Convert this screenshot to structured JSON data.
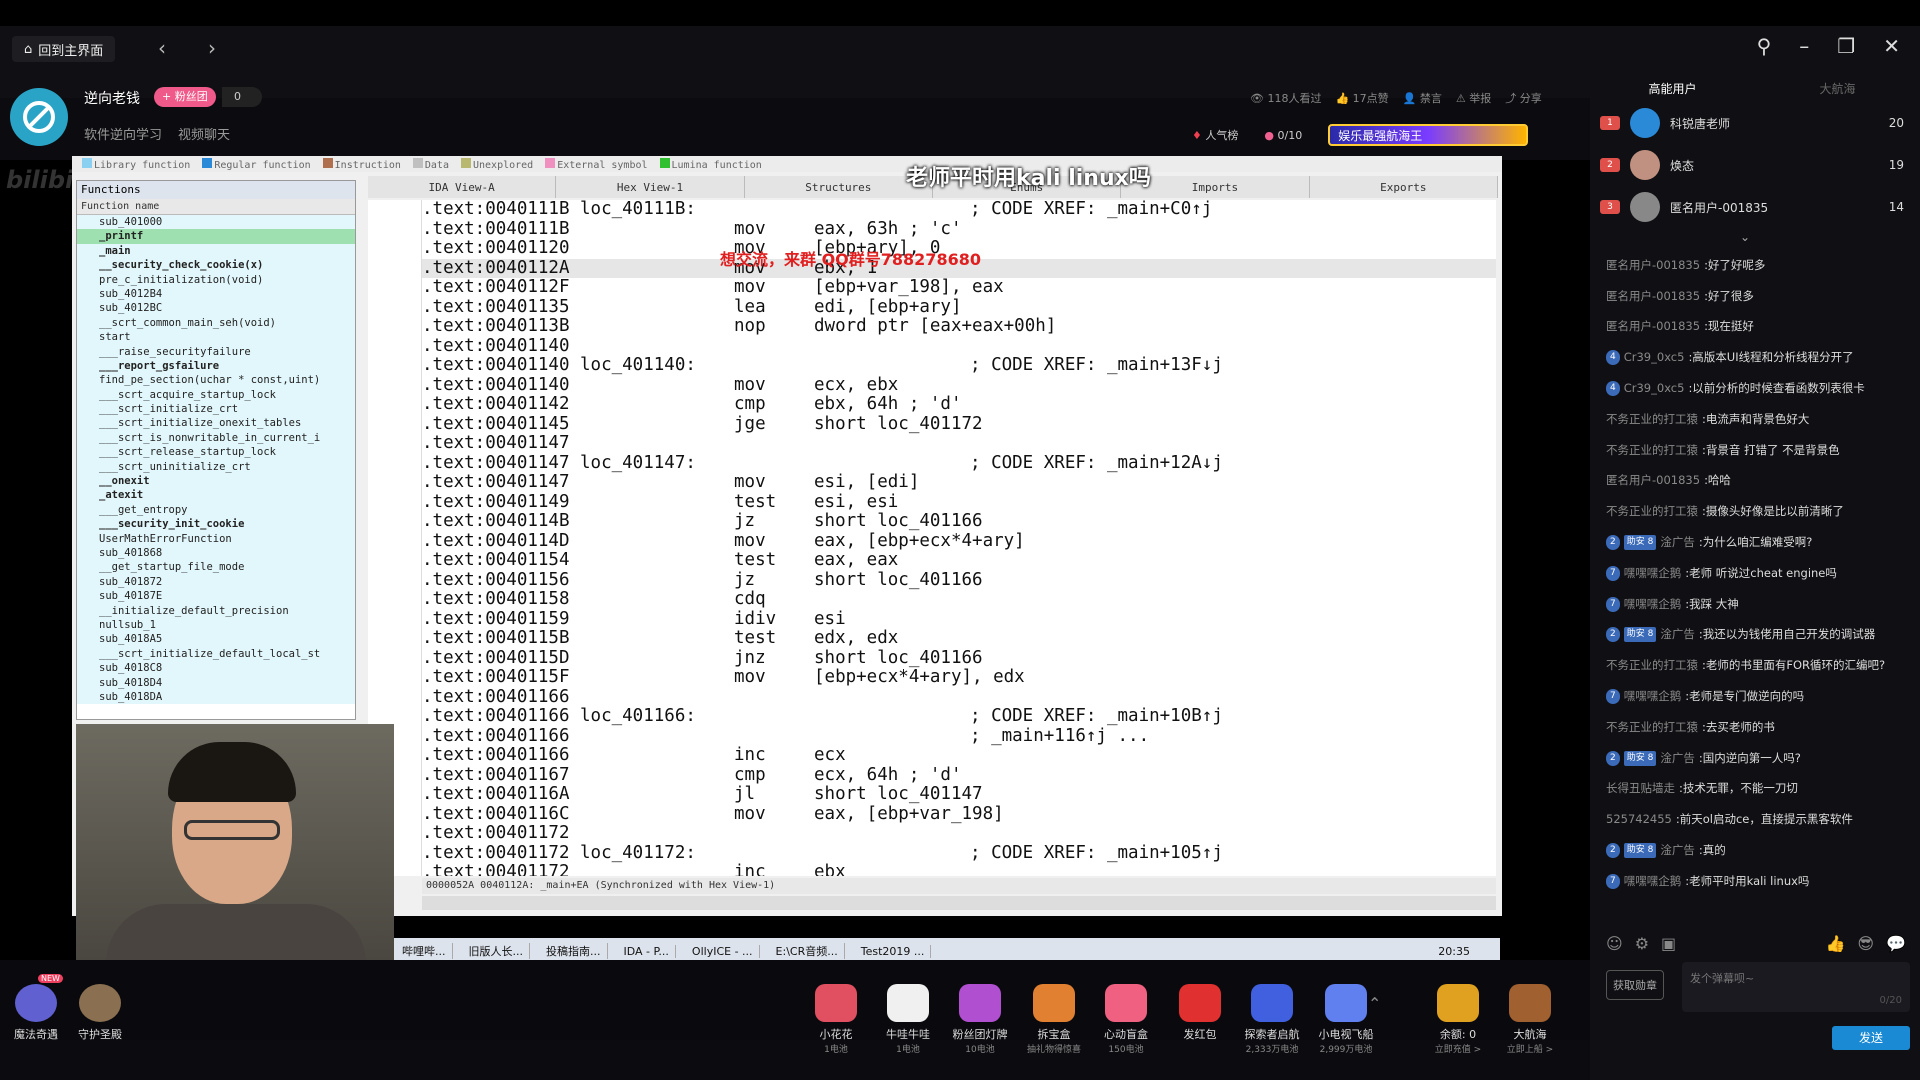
{
  "topbar": {
    "home_label": "回到主界面",
    "back_icon": "‹",
    "forward_icon": "›",
    "streamer_name": "逆向老钱",
    "fan_badge": "+ 粉丝团",
    "fan_count": "0",
    "tags": [
      "软件逆向学习",
      "视频聊天"
    ],
    "stats": [
      "118人看过",
      "17点赞",
      "禁言",
      "举报",
      "分享"
    ],
    "popularity": "人气榜",
    "gift_counter": "0/10",
    "banner_text": "娱乐最强航海王"
  },
  "ida": {
    "legend": [
      {
        "label": "Library function",
        "color": "#8ad0f0"
      },
      {
        "label": "Regular function",
        "color": "#2a8ad8"
      },
      {
        "label": "Instruction",
        "color": "#b07050"
      },
      {
        "label": "Data",
        "color": "#c0c0c0"
      },
      {
        "label": "Unexplored",
        "color": "#b8b870"
      },
      {
        "label": "External symbol",
        "color": "#f090c0"
      },
      {
        "label": "Lumina function",
        "color": "#30c030"
      }
    ],
    "functions_title": "Functions",
    "function_header": "Function name",
    "functions": [
      "sub_401000",
      "_printf",
      "_main",
      "__security_check_cookie(x)",
      "pre_c_initialization(void)",
      "sub_4012B4",
      "sub_4012BC",
      "__scrt_common_main_seh(void)",
      "start",
      "___raise_securityfailure",
      "___report_gsfailure",
      "find_pe_section(uchar * const,uint)",
      "___scrt_acquire_startup_lock",
      "___scrt_initialize_crt",
      "___scrt_initialize_onexit_tables",
      "___scrt_is_nonwritable_in_current_i",
      "___scrt_release_startup_lock",
      "___scrt_uninitialize_crt",
      "__onexit",
      "_atexit",
      "___get_entropy",
      "___security_init_cookie",
      "UserMathErrorFunction",
      "sub_401868",
      "__get_startup_file_mode",
      "sub_401872",
      "sub_40187E",
      "__initialize_default_precision",
      "nullsub_1",
      "sub_4018A5",
      "___scrt_initialize_default_local_st",
      "sub_4018C8",
      "sub_4018D4",
      "sub_4018DA"
    ],
    "tabs": [
      "IDA View-A",
      "Hex View-1",
      "Structures",
      "Enums",
      "Imports",
      "Exports"
    ],
    "code": [
      {
        "a": ".text:0040111B",
        "l": "loc_40111B:",
        "m": "",
        "o": "",
        "c": "; CODE XREF: _main+C0↑j"
      },
      {
        "a": ".text:0040111B",
        "l": "",
        "m": "mov",
        "o": "eax, 63h ; 'c'",
        "c": ""
      },
      {
        "a": ".text:00401120",
        "l": "",
        "m": "mov",
        "o": "[ebp+ary], 0",
        "c": ""
      },
      {
        "a": ".text:0040112A",
        "l": "",
        "m": "mov",
        "o": "ebx, 1",
        "c": ""
      },
      {
        "a": ".text:0040112F",
        "l": "",
        "m": "mov",
        "o": "[ebp+var_198], eax",
        "c": ""
      },
      {
        "a": ".text:00401135",
        "l": "",
        "m": "lea",
        "o": "edi, [ebp+ary]",
        "c": ""
      },
      {
        "a": ".text:0040113B",
        "l": "",
        "m": "nop",
        "o": "dword ptr [eax+eax+00h]",
        "c": ""
      },
      {
        "a": ".text:00401140",
        "l": "",
        "m": "",
        "o": "",
        "c": ""
      },
      {
        "a": ".text:00401140",
        "l": "loc_401140:",
        "m": "",
        "o": "",
        "c": "; CODE XREF: _main+13F↓j"
      },
      {
        "a": ".text:00401140",
        "l": "",
        "m": "mov",
        "o": "ecx, ebx",
        "c": ""
      },
      {
        "a": ".text:00401142",
        "l": "",
        "m": "cmp",
        "o": "ebx, 64h ; 'd'",
        "c": ""
      },
      {
        "a": ".text:00401145",
        "l": "",
        "m": "jge",
        "o": "short loc_401172",
        "c": ""
      },
      {
        "a": ".text:00401147",
        "l": "",
        "m": "",
        "o": "",
        "c": ""
      },
      {
        "a": ".text:00401147",
        "l": "loc_401147:",
        "m": "",
        "o": "",
        "c": "; CODE XREF: _main+12A↓j"
      },
      {
        "a": ".text:00401147",
        "l": "",
        "m": "mov",
        "o": "esi, [edi]",
        "c": ""
      },
      {
        "a": ".text:00401149",
        "l": "",
        "m": "test",
        "o": "esi, esi",
        "c": ""
      },
      {
        "a": ".text:0040114B",
        "l": "",
        "m": "jz",
        "o": "short loc_401166",
        "c": ""
      },
      {
        "a": ".text:0040114D",
        "l": "",
        "m": "mov",
        "o": "eax, [ebp+ecx*4+ary]",
        "c": ""
      },
      {
        "a": ".text:00401154",
        "l": "",
        "m": "test",
        "o": "eax, eax",
        "c": ""
      },
      {
        "a": ".text:00401156",
        "l": "",
        "m": "jz",
        "o": "short loc_401166",
        "c": ""
      },
      {
        "a": ".text:00401158",
        "l": "",
        "m": "cdq",
        "o": "",
        "c": ""
      },
      {
        "a": ".text:00401159",
        "l": "",
        "m": "idiv",
        "o": "esi",
        "c": ""
      },
      {
        "a": ".text:0040115B",
        "l": "",
        "m": "test",
        "o": "edx, edx",
        "c": ""
      },
      {
        "a": ".text:0040115D",
        "l": "",
        "m": "jnz",
        "o": "short loc_401166",
        "c": ""
      },
      {
        "a": ".text:0040115F",
        "l": "",
        "m": "mov",
        "o": "[ebp+ecx*4+ary], edx",
        "c": ""
      },
      {
        "a": ".text:00401166",
        "l": "",
        "m": "",
        "o": "",
        "c": ""
      },
      {
        "a": ".text:00401166",
        "l": "loc_401166:",
        "m": "",
        "o": "",
        "c": "; CODE XREF: _main+10B↑j"
      },
      {
        "a": ".text:00401166",
        "l": "",
        "m": "",
        "o": "",
        "c": "; _main+116↑j ..."
      },
      {
        "a": ".text:00401166",
        "l": "",
        "m": "inc",
        "o": "ecx",
        "c": ""
      },
      {
        "a": ".text:00401167",
        "l": "",
        "m": "cmp",
        "o": "ecx, 64h ; 'd'",
        "c": ""
      },
      {
        "a": ".text:0040116A",
        "l": "",
        "m": "jl",
        "o": "short loc_401147",
        "c": ""
      },
      {
        "a": ".text:0040116C",
        "l": "",
        "m": "mov",
        "o": "eax, [ebp+var_198]",
        "c": ""
      },
      {
        "a": ".text:00401172",
        "l": "",
        "m": "",
        "o": "",
        "c": ""
      },
      {
        "a": ".text:00401172",
        "l": "loc_401172:",
        "m": "",
        "o": "",
        "c": "; CODE XREF: _main+105↑j"
      },
      {
        "a": ".text:00401172",
        "l": "",
        "m": "inc",
        "o": "ebx",
        "c": ""
      }
    ],
    "status": "0000052A 0040112A: _main+EA (Synchronized with Hex View-1)",
    "taskbar": [
      "哔哩哔...",
      "旧版人长...",
      "投稿指南...",
      "IDA - P...",
      "OllyICE - ...",
      "E:\\CR音频...",
      "Test2019 ..."
    ],
    "clock": "20:35"
  },
  "overlays": {
    "caption": "老师平时用kali linux吗",
    "red_text": "想交流，来群 QQ群号788278680"
  },
  "bottom": {
    "left_items": [
      {
        "label": "魔法奇遇",
        "badge": "NEW"
      },
      {
        "label": "守护圣殿"
      }
    ],
    "gifts": [
      {
        "label": "小花花",
        "sub": "1电池",
        "color": "#e05060"
      },
      {
        "label": "牛哇牛哇",
        "sub": "1电池",
        "color": "#f0f0f0"
      },
      {
        "label": "粉丝团灯牌",
        "sub": "10电池",
        "color": "#b050d0"
      },
      {
        "label": "拆宝盒",
        "sub": "抽礼物得惊喜",
        "color": "#e08030"
      },
      {
        "label": "心动盲盒",
        "sub": "150电池",
        "color": "#f06080"
      },
      {
        "label": "发红包",
        "sub": "",
        "color": "#e03030"
      },
      {
        "label": "探索者启航",
        "sub": "2,333万电池",
        "color": "#4060e0"
      },
      {
        "label": "小电视飞船",
        "sub": "2,999万电池",
        "color": "#6080f0"
      },
      {
        "label": "余额: 0",
        "sub": "立即充值 >",
        "color": "#e0a020"
      },
      {
        "label": "大航海",
        "sub": "立即上船 >",
        "color": "#a06030"
      }
    ]
  },
  "side": {
    "tabs": [
      "高能用户",
      "大航海"
    ],
    "top_users": [
      {
        "rank": "1",
        "name": "科锐唐老师",
        "points": "20",
        "color": "#2a8ad8"
      },
      {
        "rank": "2",
        "name": "焕态",
        "points": "19",
        "color": "#c09080"
      },
      {
        "rank": "3",
        "name": "匿名用户-001835",
        "points": "14",
        "color": "#888"
      }
    ],
    "chat": [
      {
        "lvl": "",
        "tag": "",
        "user": "匿名用户-001835",
        "text": ":好了好呢多"
      },
      {
        "lvl": "",
        "tag": "",
        "user": "匿名用户-001835",
        "text": ":好了很多"
      },
      {
        "lvl": "",
        "tag": "",
        "user": "匿名用户-001835",
        "text": ":现在挺好"
      },
      {
        "lvl": "4",
        "tag": "",
        "user": "Cr39_0xc5",
        "text": ":高版本UI线程和分析线程分开了"
      },
      {
        "lvl": "4",
        "tag": "",
        "user": "Cr39_0xc5",
        "text": ":以前分析的时候查看函数列表很卡"
      },
      {
        "lvl": "",
        "tag": "",
        "user": "不务正业的打工猿",
        "text": ":电流声和背景色好大"
      },
      {
        "lvl": "",
        "tag": "",
        "user": "不务正业的打工猿",
        "text": ":背景音 打错了 不是背景色"
      },
      {
        "lvl": "",
        "tag": "",
        "user": "匿名用户-001835",
        "text": ":哈哈"
      },
      {
        "lvl": "",
        "tag": "",
        "user": "不务正业的打工猿",
        "text": ":摄像头好像是比以前清晰了"
      },
      {
        "lvl": "2",
        "tag": "助安 8",
        "user": "淦广告",
        "text": ":为什么咱汇编难受啊?"
      },
      {
        "lvl": "7",
        "tag": "",
        "user": "嘿嘿嘿企鹅",
        "text": ":老师 听说过cheat engine吗"
      },
      {
        "lvl": "7",
        "tag": "",
        "user": "嘿嘿嘿企鹅",
        "text": ":我踩 大神"
      },
      {
        "lvl": "2",
        "tag": "助安 8",
        "user": "淦广告",
        "text": ":我还以为钱佬用自己开发的调试器"
      },
      {
        "lvl": "",
        "tag": "",
        "user": "不务正业的打工猿",
        "text": ":老师的书里面有FOR循环的汇编吧?"
      },
      {
        "lvl": "7",
        "tag": "",
        "user": "嘿嘿嘿企鹅",
        "text": ":老师是专门做逆向的吗"
      },
      {
        "lvl": "",
        "tag": "",
        "user": "不务正业的打工猿",
        "text": ":去买老师的书"
      },
      {
        "lvl": "2",
        "tag": "助安 8",
        "user": "淦广告",
        "text": ":国内逆向第一人吗?"
      },
      {
        "lvl": "",
        "tag": "",
        "user": "长得丑贴墙走",
        "text": ":技术无罪，不能一刀切"
      },
      {
        "lvl": "",
        "tag": "",
        "user": "525742455",
        "text": ":前天ol启动ce，直接提示黑客软件"
      },
      {
        "lvl": "2",
        "tag": "助安 8",
        "user": "淦广告",
        "text": ":真的"
      },
      {
        "lvl": "7",
        "tag": "",
        "user": "嘿嘿嘿企鹅",
        "text": ":老师平时用kali linux吗"
      }
    ],
    "medal_label": "获取勋章",
    "input_placeholder": "发个弹幕呗~",
    "input_count": "0/20",
    "send_label": "发送"
  }
}
